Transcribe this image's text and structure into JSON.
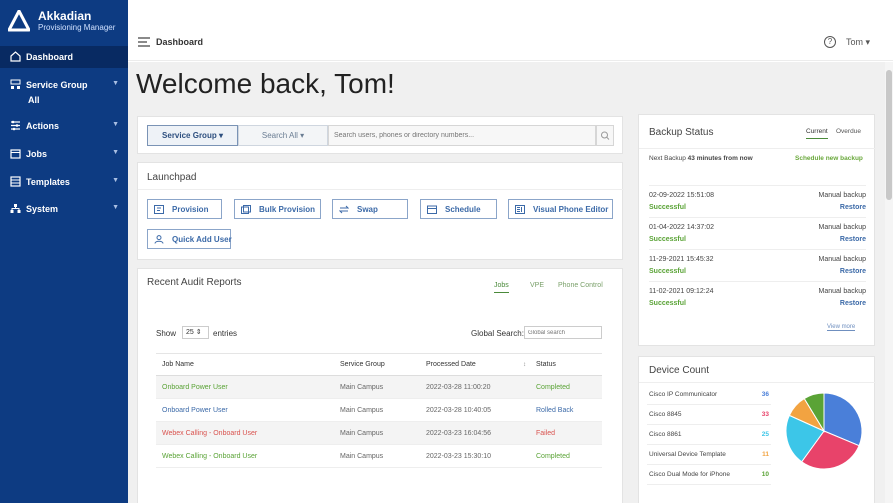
{
  "app": {
    "name": "Akkadian",
    "subtitle": "Provisioning Manager"
  },
  "sidebar": {
    "items": [
      {
        "label": "Dashboard",
        "icon": "home-icon"
      },
      {
        "label": "Service Group",
        "icon": "sitemap-icon",
        "sub": "All"
      },
      {
        "label": "Actions",
        "icon": "sliders-icon"
      },
      {
        "label": "Jobs",
        "icon": "calendar-icon"
      },
      {
        "label": "Templates",
        "icon": "layers-icon"
      },
      {
        "label": "System",
        "icon": "network-icon"
      }
    ],
    "colors": {
      "bg": "#0d3b82",
      "active": "#082a62"
    }
  },
  "header": {
    "title": "Dashboard",
    "help": "?",
    "user": "Tom ▾"
  },
  "welcome": "Welcome back, Tom!",
  "search": {
    "service_group": "Service Group ▾",
    "search_all": "Search All ▾",
    "placeholder": "Search users, phones or directory numbers..."
  },
  "launchpad": {
    "title": "Launchpad",
    "buttons": [
      "Provision",
      "Bulk Provision",
      "Swap",
      "Schedule",
      "Visual Phone Editor",
      "Quick Add User"
    ]
  },
  "audit": {
    "title": "Recent Audit Reports",
    "tabs": [
      "Jobs",
      "VPE",
      "Phone Control"
    ],
    "show": "Show",
    "entries_value": "25 ⇕",
    "entries": "entries",
    "global_search": "Global Search:",
    "global_search_placeholder": "Global search",
    "columns": [
      "Job Name",
      "Service Group",
      "Processed Date",
      "Status"
    ],
    "sort_icon": "↕",
    "rows": [
      {
        "job": "Onboard Power User",
        "group": "Main Campus",
        "date": "2022-03-28 11:00:20",
        "status": "Completed",
        "job_color": "#5aa336",
        "status_color": "#5aa336"
      },
      {
        "job": "Onboard Power User",
        "group": "Main Campus",
        "date": "2022-03-28 10:40:05",
        "status": "Rolled Back",
        "job_color": "#3c6aa8",
        "status_color": "#3c6aa8"
      },
      {
        "job": "Webex Calling - Onboard User",
        "group": "Main Campus",
        "date": "2022-03-23 16:04:56",
        "status": "Failed",
        "job_color": "#d9534f",
        "status_color": "#d9534f"
      },
      {
        "job": "Webex Calling - Onboard User",
        "group": "Main Campus",
        "date": "2022-03-23 15:30:10",
        "status": "Completed",
        "job_color": "#5aa336",
        "status_color": "#5aa336"
      }
    ]
  },
  "backup": {
    "title": "Backup Status",
    "tabs": [
      "Current",
      "Overdue"
    ],
    "next_label": "Next Backup",
    "next_value": "43 minutes from now",
    "schedule": "Schedule new backup",
    "entries": [
      {
        "date": "02-09-2022 15:51:08",
        "type": "Manual backup",
        "result": "Successful",
        "restore": "Restore"
      },
      {
        "date": "01-04-2022 14:37:02",
        "type": "Manual backup",
        "result": "Successful",
        "restore": "Restore"
      },
      {
        "date": "11-29-2021 15:45:32",
        "type": "Manual backup",
        "result": "Successful",
        "restore": "Restore"
      },
      {
        "date": "11-02-2021 09:12:24",
        "type": "Manual backup",
        "result": "Successful",
        "restore": "Restore"
      }
    ],
    "view_more": "View more"
  },
  "device_count": {
    "title": "Device Count",
    "devices": [
      {
        "name": "Cisco IP Communicator",
        "count": "36",
        "color": "#4a7fd9"
      },
      {
        "name": "Cisco 8845",
        "count": "33",
        "color": "#e8436a"
      },
      {
        "name": "Cisco 8861",
        "count": "25",
        "color": "#3cc6e8"
      },
      {
        "name": "Universal Device Template",
        "count": "11",
        "color": "#f2a341"
      },
      {
        "name": "Cisco Dual Mode for iPhone",
        "count": "10",
        "color": "#5aa336"
      }
    ]
  },
  "colors": {
    "accent_green": "#5aa336",
    "link_blue": "#3c6aa8"
  }
}
